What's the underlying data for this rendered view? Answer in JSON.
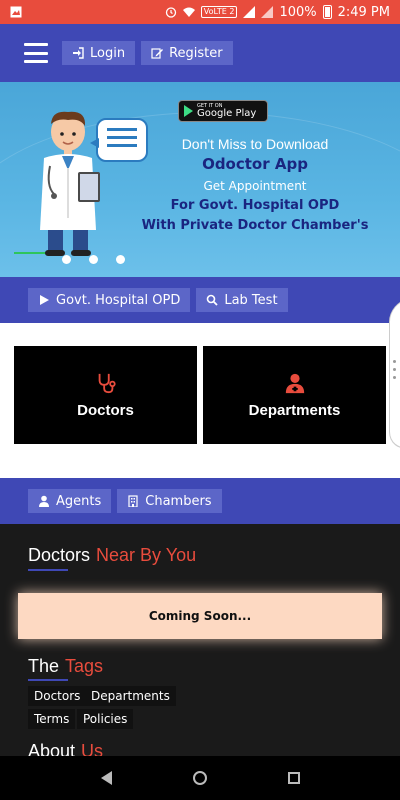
{
  "status_bar": {
    "volte": "VoLTE 2",
    "battery": "100%",
    "time": "2:49 PM"
  },
  "topnav": {
    "login_label": "Login",
    "register_label": "Register"
  },
  "banner": {
    "store_small": "GET IT ON",
    "store_big": "Google Play",
    "line1": "Don't Miss to Download",
    "line2": "Odoctor App",
    "line3": "Get Appointment",
    "line4": "For Govt. Hospital OPD",
    "line5": "With Private Doctor Chamber's"
  },
  "section_nav_1": {
    "govt_opd": "Govt. Hospital OPD",
    "lab_test": "Lab Test"
  },
  "cards": {
    "doctors": "Doctors",
    "departments": "Departments"
  },
  "section_nav_2": {
    "agents": "Agents",
    "chambers": "Chambers"
  },
  "nearby": {
    "title": "Doctors",
    "title_accent": "Near By You",
    "coming_soon": "Coming Soon..."
  },
  "tags": {
    "title": "The",
    "title_accent": "Tags",
    "items": [
      "Doctors",
      "Departments",
      "Terms",
      "Policies"
    ]
  },
  "about": {
    "title": "About",
    "title_accent": "Us"
  },
  "colors": {
    "primary": "#3f48b5",
    "accent": "#e84c3d",
    "dark_bg": "#1a1a1a"
  }
}
